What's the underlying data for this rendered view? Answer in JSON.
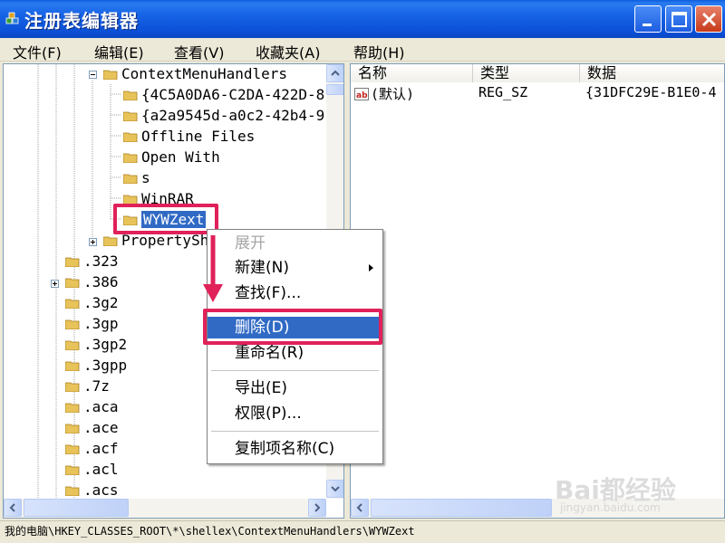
{
  "window": {
    "title": "注册表编辑器",
    "accent": "#0B4FD6",
    "controls": [
      "minimize-icon",
      "maximize-icon",
      "close-icon"
    ]
  },
  "menubar": {
    "items": [
      "文件(F)",
      "编辑(E)",
      "查看(V)",
      "收藏夹(A)",
      "帮助(H)"
    ]
  },
  "tree": {
    "nodes": [
      {
        "label": "ContextMenuHandlers",
        "expander": "minus"
      },
      {
        "label": "{4C5A0DA6-C2DA-422D-8"
      },
      {
        "label": "{a2a9545d-a0c2-42b4-9"
      },
      {
        "label": "Offline Files"
      },
      {
        "label": "Open With"
      },
      {
        "label": "s"
      },
      {
        "label": "WinRAR"
      },
      {
        "label": "WYWZext",
        "selected": true
      },
      {
        "label": "PropertySh",
        "expander": "plus"
      },
      {
        "label": ".323"
      },
      {
        "label": ".386",
        "expander": "plus"
      },
      {
        "label": ".3g2"
      },
      {
        "label": ".3gp"
      },
      {
        "label": ".3gp2"
      },
      {
        "label": ".3gpp"
      },
      {
        "label": ".7z"
      },
      {
        "label": ".aca"
      },
      {
        "label": ".ace"
      },
      {
        "label": ".acf"
      },
      {
        "label": ".acl"
      },
      {
        "label": ".acs"
      }
    ]
  },
  "list": {
    "columns": [
      "名称",
      "类型",
      "数据"
    ],
    "rows": [
      {
        "name": "(默认)",
        "type": "REG_SZ",
        "data": "{31DFC29E-B1E0-4"
      }
    ]
  },
  "context_menu": {
    "items": [
      {
        "label": "展开",
        "disabled": true
      },
      {
        "label": "新建(N)",
        "submenu": true
      },
      {
        "label": "查找(F)..."
      },
      {
        "label": "删除(D)",
        "highlighted": true
      },
      {
        "label": "重命名(R)"
      },
      {
        "label": "导出(E)"
      },
      {
        "label": "权限(P)..."
      },
      {
        "label": "复制项名称(C)"
      }
    ]
  },
  "status": {
    "path": "我的电脑\\HKEY_CLASSES_ROOT\\*\\shellex\\ContextMenuHandlers\\WYWZext"
  },
  "annotations": {
    "highlight_color": "#E0215A"
  },
  "watermark": {
    "brand": "Bai都经验",
    "url": "jingyan.baidu.com"
  }
}
